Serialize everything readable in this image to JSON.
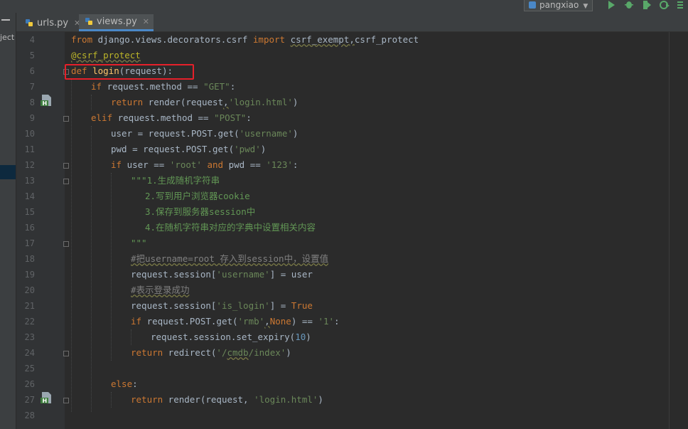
{
  "toolbar": {
    "run_config": "pangxiao",
    "icons": [
      "run-icon",
      "debug-icon",
      "coverage-icon",
      "profile-icon",
      "stop-icon"
    ]
  },
  "left_panel": {
    "label": "ject"
  },
  "tabs": [
    {
      "label": "urls.py",
      "active": false
    },
    {
      "label": "views.py",
      "active": true
    }
  ],
  "editor": {
    "line_numbers": [
      "4",
      "5",
      "6",
      "7",
      "8",
      "9",
      "10",
      "11",
      "12",
      "13",
      "14",
      "15",
      "16",
      "17",
      "18",
      "19",
      "20",
      "21",
      "22",
      "23",
      "24",
      "25",
      "26",
      "27",
      "28"
    ],
    "gutter_markers": [
      {
        "line": "8",
        "icon": "html-template-icon",
        "badge": "H"
      },
      {
        "line": "27",
        "icon": "html-template-icon",
        "badge": "H"
      }
    ]
  },
  "code": {
    "l4": {
      "kw1": "from",
      "t1": " django.views.decorators.csrf ",
      "kw2": "import",
      "t2": " ",
      "w1": "csrf_exempt,",
      "t3": "csrf_protect"
    },
    "l5": {
      "dec": "@csrf_protect"
    },
    "l6": {
      "kw": "def",
      "t1": " ",
      "fn": "login",
      "t2": "(request):"
    },
    "l7": {
      "kw": "if",
      "t1": " request.method == ",
      "st": "\"GET\"",
      "t2": ":"
    },
    "l8": {
      "kw": "return",
      "t1": " render(request",
      "w": ",",
      "st": "'login.html'",
      "t2": ")"
    },
    "l9": {
      "kw": "elif",
      "t1": " request.method == ",
      "st": "\"POST\"",
      "t2": ":"
    },
    "l10": {
      "t1": "user = request.POST.get(",
      "st": "'username'",
      "t2": ")"
    },
    "l11": {
      "t1": "pwd = request.POST.get(",
      "st": "'pwd'",
      "t2": ")"
    },
    "l12": {
      "kw1": "if",
      "t1": " user == ",
      "st1": "'root'",
      "t2": " ",
      "kw2": "and",
      "t3": " pwd == ",
      "st2": "'123'",
      "t4": ":"
    },
    "l13": {
      "doc": "\"\"\"1.生成随机字符串"
    },
    "l14": {
      "doc": "2.写到用户浏览器cookie"
    },
    "l15": {
      "doc": "3.保存到服务器session中"
    },
    "l16": {
      "doc": "4.在随机字符串对应的字典中设置相关内容"
    },
    "l17": {
      "doc": "\"\"\""
    },
    "l18": {
      "cm": "#把username=root 存入到session中，设置值"
    },
    "l19": {
      "t1": "request.session[",
      "st": "'username'",
      "t2": "] = user"
    },
    "l20": {
      "cm": "#表示登录成功"
    },
    "l21": {
      "t1": "request.session[",
      "st": "'is_login'",
      "t2": "] = ",
      "kw": "True"
    },
    "l22": {
      "kw": "if",
      "t1": " request.POST.get(",
      "st1": "'rmb'",
      "w": ",",
      "kw2": "None",
      "t2": ") == ",
      "st2": "'1'",
      "t3": ":"
    },
    "l23": {
      "t1": "request.session.set_expiry(",
      "num": "10",
      "t2": ")"
    },
    "l24": {
      "kw": "return",
      "t1": " redirect(",
      "st1": "'/",
      "w": "cmdb",
      "st2": "/index'",
      "t2": ")"
    },
    "l26": {
      "kw": "else",
      "t1": ":"
    },
    "l27": {
      "kw": "return",
      "t1": " render(request, ",
      "st": "'login.html'",
      "t2": ")"
    }
  }
}
